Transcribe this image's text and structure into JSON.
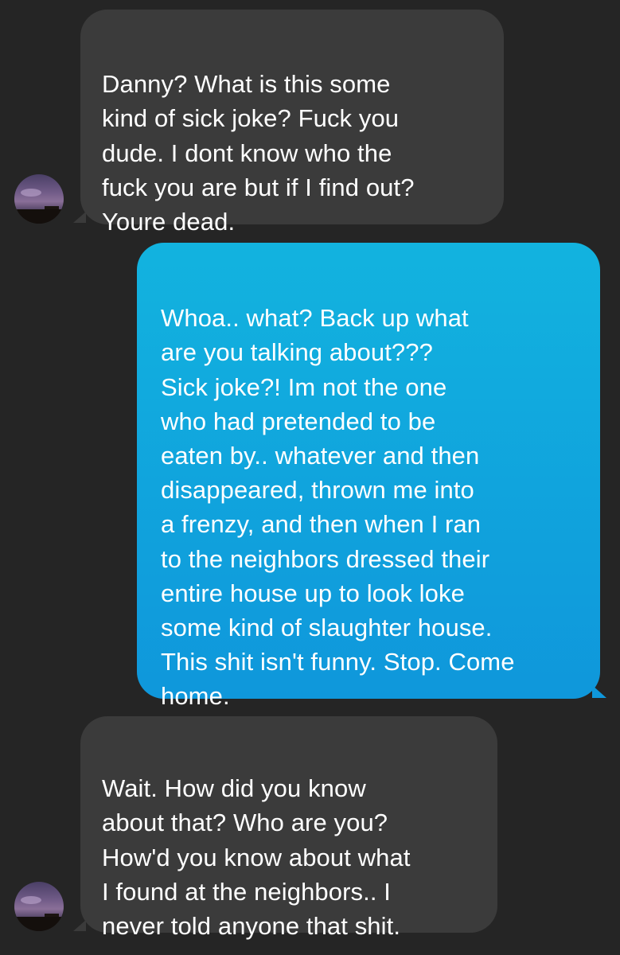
{
  "conversation": {
    "messages": [
      {
        "direction": "incoming",
        "text": "Danny? What is this some\nkind of sick joke? Fuck you\ndude. I dont know who the\nfuck you are but if I find out?\nYoure dead."
      },
      {
        "direction": "outgoing",
        "text": "Whoa.. what? Back up what\nare you talking about???\nSick joke?! Im not the one\nwho had pretended to be\neaten by.. whatever and then\ndisappeared, thrown me into\na frenzy, and then when I ran\nto the neighbors dressed their\nentire house up to look loke\nsome kind of slaughter house.\nThis shit isn't funny. Stop. Come\nhome."
      },
      {
        "direction": "incoming",
        "text": "Wait. How did you know\nabout that? Who are you?\nHow'd you know about what\nI found at the neighbors.. I\nnever told anyone that shit."
      }
    ]
  },
  "colors": {
    "background": "#252525",
    "incoming_bubble": "#3b3b3b",
    "outgoing_bubble_top": "#12b3df",
    "outgoing_bubble_bottom": "#0f97db",
    "text": "#ffffff"
  },
  "icons": {
    "contact_avatar": "sunset-photo-avatar"
  }
}
